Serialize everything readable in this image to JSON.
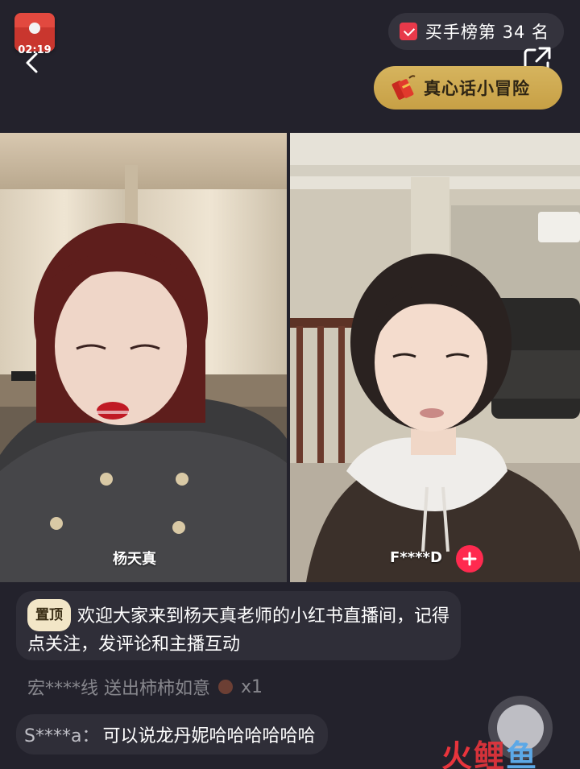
{
  "header": {
    "red_packet_timer": "02:19",
    "rank_label": "买手榜第 34 名",
    "game_label": "真心话小冒险"
  },
  "video": {
    "host_name": "杨天真",
    "guest_name": "F****D"
  },
  "chat": {
    "pinned_badge": "置顶",
    "pinned_text": "欢迎大家来到杨天真老师的小红书直播间，记得点关注，发评论和主播互动",
    "gift_text": "宏****线 送出柿柿如意",
    "gift_count": "x1",
    "message_user": "S****a：",
    "message_text": "可以说龙丹妮哈哈哈哈哈哈"
  },
  "watermark": {
    "part1": "火",
    "part2": "鲤",
    "part3": "鱼"
  },
  "colors": {
    "background": "#23222c",
    "accent_red": "#ff2a4f",
    "gold": "#d6b45e"
  }
}
